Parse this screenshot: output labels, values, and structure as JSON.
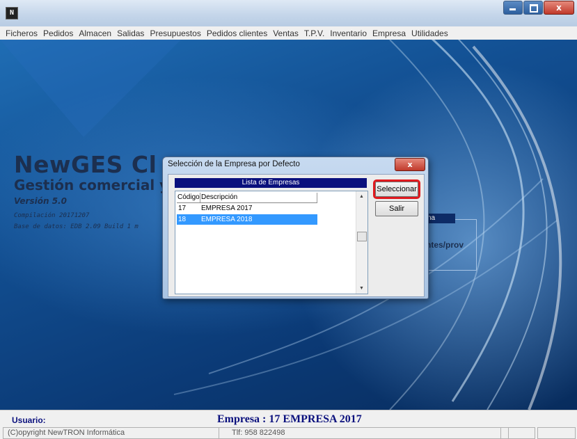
{
  "window": {
    "icon_label": "N"
  },
  "menu": [
    "Ficheros",
    "Pedidos",
    "Almacen",
    "Salidas",
    "Presupuestos",
    "Pedidos clientes",
    "Ventas",
    "T.P.V.",
    "Inventario",
    "Empresa",
    "Utilidades"
  ],
  "background": {
    "title": "NewGES Cl",
    "subtitle": "Gestión comercial y",
    "version": "Versión 5.0",
    "compilation": "Compilación 20171207",
    "database": "Base de datos: EDB 2.09 Build 1 m",
    "right_banner": "na",
    "right_label": "ntes/prov"
  },
  "dialog": {
    "title": "Selección de la Empresa por Defecto",
    "close_glyph": "x",
    "list_title": "Lista de Empresas",
    "columns": [
      "Código",
      "Descripción"
    ],
    "rows": [
      {
        "code": "17",
        "desc": "EMPRESA 2017",
        "selected": false
      },
      {
        "code": "18",
        "desc": "EMPRESA 2018",
        "selected": true
      }
    ],
    "select_button": "Seleccionar",
    "exit_button": "Salir"
  },
  "status": {
    "user_label": "Usuario:",
    "empresa": "Empresa : 17 EMPRESA 2017",
    "copyright": "(C)opyright NewTRON Informática",
    "phone": "Tlf: 958 822498"
  },
  "colors": {
    "highlight": "#e0191e",
    "selection": "#3399ff",
    "navy": "#0a107d"
  }
}
